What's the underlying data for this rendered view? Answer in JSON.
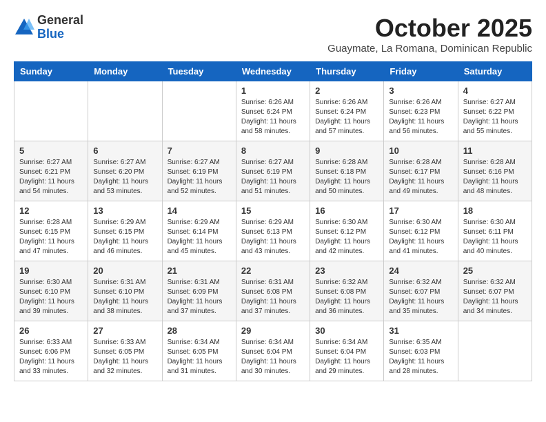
{
  "header": {
    "logo_general": "General",
    "logo_blue": "Blue",
    "month_title": "October 2025",
    "location": "Guaymate, La Romana, Dominican Republic"
  },
  "weekdays": [
    "Sunday",
    "Monday",
    "Tuesday",
    "Wednesday",
    "Thursday",
    "Friday",
    "Saturday"
  ],
  "weeks": [
    [
      {
        "day": "",
        "info": ""
      },
      {
        "day": "",
        "info": ""
      },
      {
        "day": "",
        "info": ""
      },
      {
        "day": "1",
        "info": "Sunrise: 6:26 AM\nSunset: 6:24 PM\nDaylight: 11 hours\nand 58 minutes."
      },
      {
        "day": "2",
        "info": "Sunrise: 6:26 AM\nSunset: 6:24 PM\nDaylight: 11 hours\nand 57 minutes."
      },
      {
        "day": "3",
        "info": "Sunrise: 6:26 AM\nSunset: 6:23 PM\nDaylight: 11 hours\nand 56 minutes."
      },
      {
        "day": "4",
        "info": "Sunrise: 6:27 AM\nSunset: 6:22 PM\nDaylight: 11 hours\nand 55 minutes."
      }
    ],
    [
      {
        "day": "5",
        "info": "Sunrise: 6:27 AM\nSunset: 6:21 PM\nDaylight: 11 hours\nand 54 minutes."
      },
      {
        "day": "6",
        "info": "Sunrise: 6:27 AM\nSunset: 6:20 PM\nDaylight: 11 hours\nand 53 minutes."
      },
      {
        "day": "7",
        "info": "Sunrise: 6:27 AM\nSunset: 6:19 PM\nDaylight: 11 hours\nand 52 minutes."
      },
      {
        "day": "8",
        "info": "Sunrise: 6:27 AM\nSunset: 6:19 PM\nDaylight: 11 hours\nand 51 minutes."
      },
      {
        "day": "9",
        "info": "Sunrise: 6:28 AM\nSunset: 6:18 PM\nDaylight: 11 hours\nand 50 minutes."
      },
      {
        "day": "10",
        "info": "Sunrise: 6:28 AM\nSunset: 6:17 PM\nDaylight: 11 hours\nand 49 minutes."
      },
      {
        "day": "11",
        "info": "Sunrise: 6:28 AM\nSunset: 6:16 PM\nDaylight: 11 hours\nand 48 minutes."
      }
    ],
    [
      {
        "day": "12",
        "info": "Sunrise: 6:28 AM\nSunset: 6:15 PM\nDaylight: 11 hours\nand 47 minutes."
      },
      {
        "day": "13",
        "info": "Sunrise: 6:29 AM\nSunset: 6:15 PM\nDaylight: 11 hours\nand 46 minutes."
      },
      {
        "day": "14",
        "info": "Sunrise: 6:29 AM\nSunset: 6:14 PM\nDaylight: 11 hours\nand 45 minutes."
      },
      {
        "day": "15",
        "info": "Sunrise: 6:29 AM\nSunset: 6:13 PM\nDaylight: 11 hours\nand 43 minutes."
      },
      {
        "day": "16",
        "info": "Sunrise: 6:30 AM\nSunset: 6:12 PM\nDaylight: 11 hours\nand 42 minutes."
      },
      {
        "day": "17",
        "info": "Sunrise: 6:30 AM\nSunset: 6:12 PM\nDaylight: 11 hours\nand 41 minutes."
      },
      {
        "day": "18",
        "info": "Sunrise: 6:30 AM\nSunset: 6:11 PM\nDaylight: 11 hours\nand 40 minutes."
      }
    ],
    [
      {
        "day": "19",
        "info": "Sunrise: 6:30 AM\nSunset: 6:10 PM\nDaylight: 11 hours\nand 39 minutes."
      },
      {
        "day": "20",
        "info": "Sunrise: 6:31 AM\nSunset: 6:10 PM\nDaylight: 11 hours\nand 38 minutes."
      },
      {
        "day": "21",
        "info": "Sunrise: 6:31 AM\nSunset: 6:09 PM\nDaylight: 11 hours\nand 37 minutes."
      },
      {
        "day": "22",
        "info": "Sunrise: 6:31 AM\nSunset: 6:08 PM\nDaylight: 11 hours\nand 37 minutes."
      },
      {
        "day": "23",
        "info": "Sunrise: 6:32 AM\nSunset: 6:08 PM\nDaylight: 11 hours\nand 36 minutes."
      },
      {
        "day": "24",
        "info": "Sunrise: 6:32 AM\nSunset: 6:07 PM\nDaylight: 11 hours\nand 35 minutes."
      },
      {
        "day": "25",
        "info": "Sunrise: 6:32 AM\nSunset: 6:07 PM\nDaylight: 11 hours\nand 34 minutes."
      }
    ],
    [
      {
        "day": "26",
        "info": "Sunrise: 6:33 AM\nSunset: 6:06 PM\nDaylight: 11 hours\nand 33 minutes."
      },
      {
        "day": "27",
        "info": "Sunrise: 6:33 AM\nSunset: 6:05 PM\nDaylight: 11 hours\nand 32 minutes."
      },
      {
        "day": "28",
        "info": "Sunrise: 6:34 AM\nSunset: 6:05 PM\nDaylight: 11 hours\nand 31 minutes."
      },
      {
        "day": "29",
        "info": "Sunrise: 6:34 AM\nSunset: 6:04 PM\nDaylight: 11 hours\nand 30 minutes."
      },
      {
        "day": "30",
        "info": "Sunrise: 6:34 AM\nSunset: 6:04 PM\nDaylight: 11 hours\nand 29 minutes."
      },
      {
        "day": "31",
        "info": "Sunrise: 6:35 AM\nSunset: 6:03 PM\nDaylight: 11 hours\nand 28 minutes."
      },
      {
        "day": "",
        "info": ""
      }
    ]
  ]
}
